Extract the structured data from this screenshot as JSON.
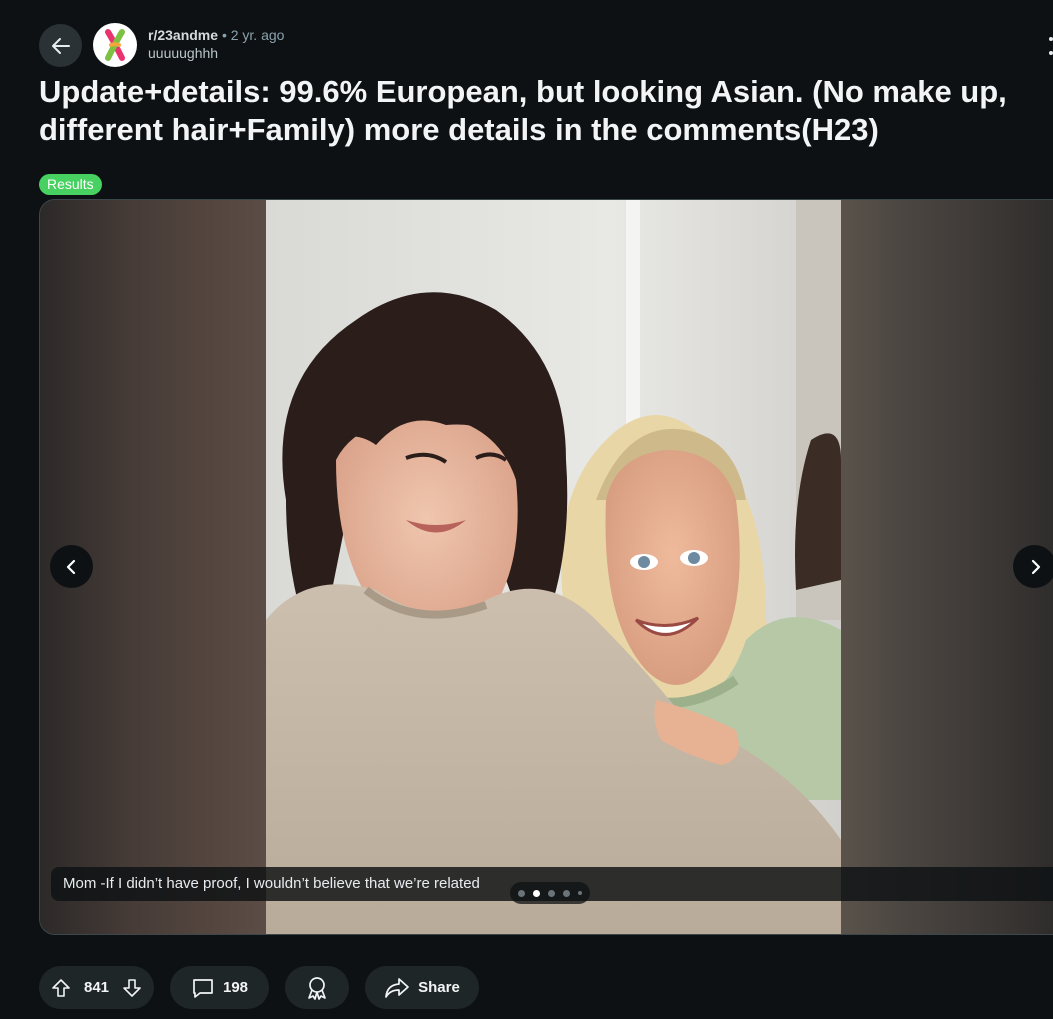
{
  "post": {
    "subreddit": "r/23andme",
    "separator": "•",
    "time_ago": "2 yr. ago",
    "author": "uuuuughhh",
    "title": "Update+details: 99.6% European, but looking Asian. (No make up, different hair+Family) more details in the comments(H23)",
    "flair": "Results"
  },
  "gallery": {
    "caption": "Mom -If I didn’t have proof, I wouldn’t believe that we’re related",
    "image_count": 5,
    "active_index": 1
  },
  "actions": {
    "upvotes": "841",
    "comments": "198",
    "share_label": "Share"
  },
  "colors": {
    "background": "#0e1113",
    "flair": "#46d160",
    "pill": "#1f2628"
  },
  "icons": [
    "back-arrow-icon",
    "subreddit-logo-icon",
    "more-options-icon",
    "chevron-left-icon",
    "chevron-right-icon",
    "upvote-icon",
    "downvote-icon",
    "comment-icon",
    "award-icon",
    "share-icon"
  ]
}
